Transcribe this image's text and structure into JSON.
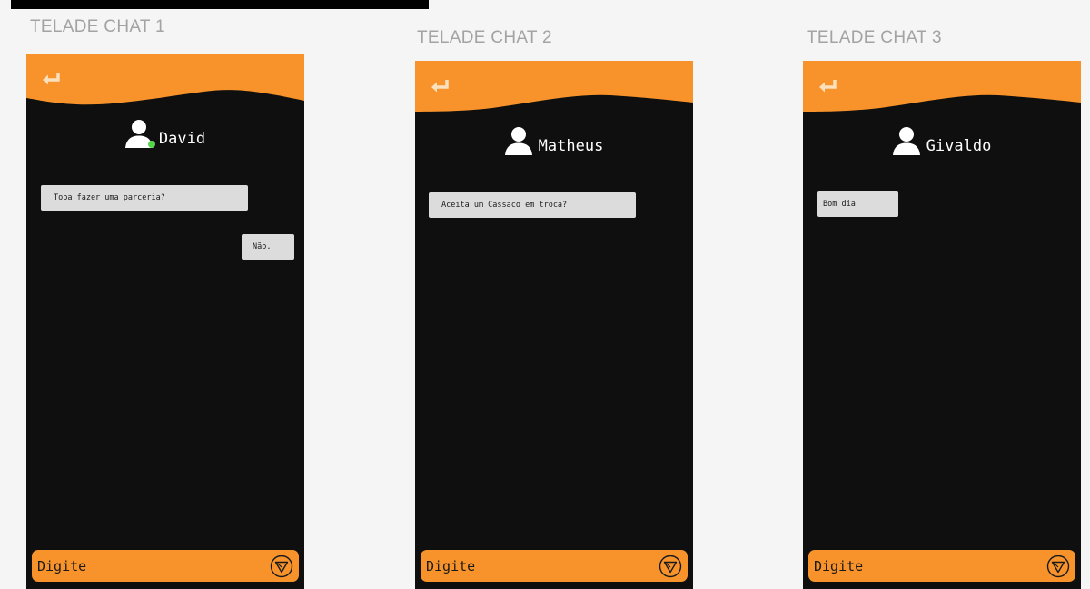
{
  "frames": [
    {
      "label": "TELADE CHAT 1",
      "contact_name": "David",
      "online": true,
      "messages": [
        {
          "text": "Topa fazer uma parceria?",
          "side": "left"
        },
        {
          "text": "Não.",
          "side": "right"
        }
      ],
      "input_placeholder": "Digite"
    },
    {
      "label": "TELADE CHAT 2",
      "contact_name": "Matheus",
      "online": false,
      "messages": [
        {
          "text": "Aceita um Cassaco em troca?",
          "side": "left"
        }
      ],
      "input_placeholder": "Digite"
    },
    {
      "label": "TELADE CHAT 3",
      "contact_name": "Givaldo",
      "online": false,
      "messages": [
        {
          "text": "Bom dia",
          "side": "left"
        }
      ],
      "input_placeholder": "Digite"
    }
  ],
  "icons": {
    "back": "return-arrow-icon",
    "avatar": "user-icon",
    "send": "send-icon"
  },
  "colors": {
    "accent": "#f7932a",
    "phone_background": "#0f0f0f",
    "bubble": "#dcdcdc",
    "online": "#55d64c",
    "canvas": "#f5f5f5",
    "label": "#a3a3a3"
  }
}
